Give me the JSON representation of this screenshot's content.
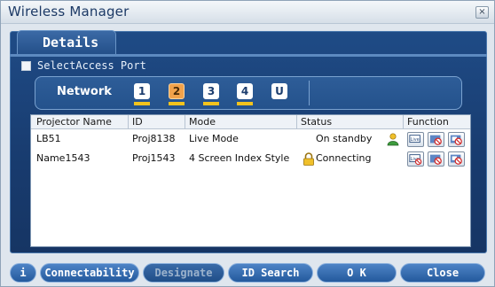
{
  "window": {
    "title": "Wireless Manager",
    "close_glyph": "×"
  },
  "tabs": [
    {
      "label": "Details",
      "active": true
    }
  ],
  "access_port": {
    "label": "SelectAccess Port",
    "checked": false
  },
  "network": {
    "label": "Network",
    "buttons": [
      {
        "label": "1",
        "style": "white",
        "underline": "#f2c31d"
      },
      {
        "label": "2",
        "style": "orange",
        "underline": "#f2c31d"
      },
      {
        "label": "3",
        "style": "white",
        "underline": "#f2c31d"
      },
      {
        "label": "4",
        "style": "white",
        "underline": "#f2c31d"
      },
      {
        "label": "U",
        "style": "white",
        "underline": ""
      }
    ]
  },
  "table": {
    "headers": [
      "Projector Name",
      "ID",
      "Mode",
      "Status",
      "Function"
    ],
    "rows": [
      {
        "name": "LB51",
        "id": "Proj8138",
        "mode": "Live Mode",
        "status": "On standby",
        "status_icon": "person-icon",
        "functions": [
          "live-icon",
          "no-audio-icon",
          "no-video-icon"
        ]
      },
      {
        "name": "Name1543",
        "id": "Proj1543",
        "mode": "4 Screen Index Style",
        "status": "Connecting",
        "status_icon": "lock-icon",
        "functions": [
          "live-icon",
          "no-audio-icon",
          "no-video-icon"
        ]
      }
    ]
  },
  "bottom_buttons": {
    "info": "i",
    "connectability": "Connectability",
    "designate": "Designate",
    "id_search": "ID Search",
    "ok": "O K",
    "close": "Close"
  },
  "colors": {
    "panel": "#1f4b86",
    "accent_yellow": "#f2c31d",
    "orange": "#f2a24b"
  }
}
